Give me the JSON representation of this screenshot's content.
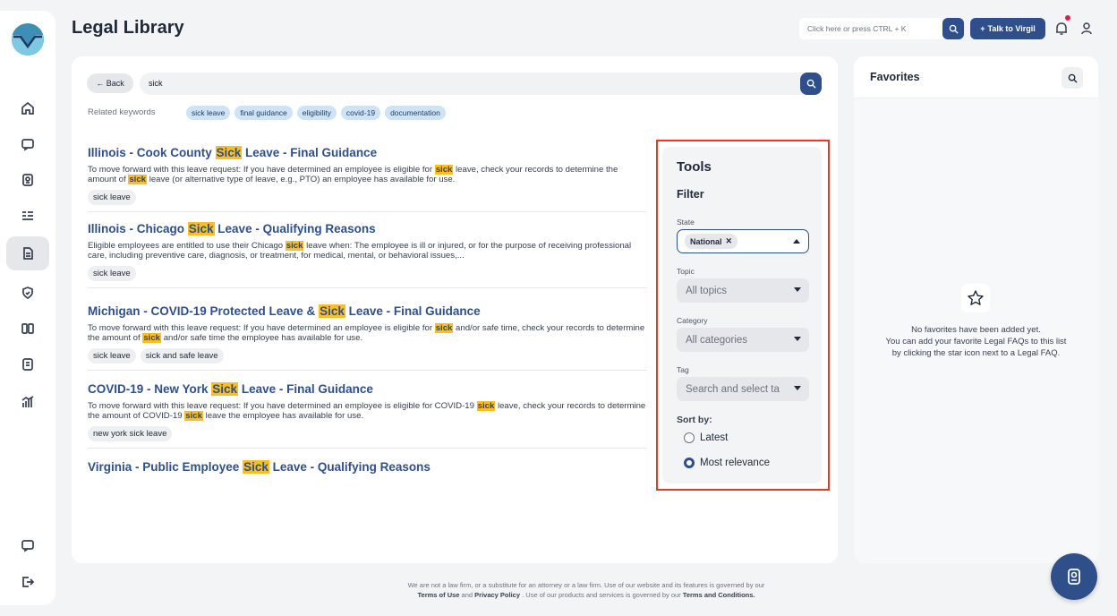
{
  "header": {
    "title": "Legal Library",
    "search_placeholder": "Click here or press CTRL + K",
    "talk_button": "Talk to Virgil"
  },
  "search": {
    "back_label": "← Back",
    "query": "sick",
    "related_label": "Related keywords",
    "keywords": [
      "sick leave",
      "final guidance",
      "eligibility",
      "covid-19",
      "documentation"
    ]
  },
  "results": [
    {
      "title_pre": "Illinois - Cook County ",
      "title_hl": "Sick",
      "title_post": " Leave - Final Guidance",
      "desc": [
        {
          "t": "To move forward with this leave request: If you have determined an employee is eligible for "
        },
        {
          "h": "sick"
        },
        {
          "t": " leave, check your records to determine the amount of "
        },
        {
          "h": "sick"
        },
        {
          "t": " leave (or alternative type of leave, e.g., PTO) an employee has available for use."
        }
      ],
      "tags": [
        "sick leave"
      ]
    },
    {
      "title_pre": "Illinois - Chicago ",
      "title_hl": "Sick",
      "title_post": " Leave - Qualifying Reasons",
      "desc": [
        {
          "t": "Eligible employees are entitled to use their Chicago "
        },
        {
          "h": "sick"
        },
        {
          "t": " leave when: The employee is ill or injured, or for the purpose of receiving professional care, including preventive care, diagnosis, or treatment, for medical, mental, or behavioral issues,..."
        }
      ],
      "tags": [
        "sick leave"
      ]
    },
    {
      "title_pre": "Michigan - COVID-19 Protected Leave & ",
      "title_hl": "Sick",
      "title_post": " Leave - Final Guidance",
      "desc": [
        {
          "t": "To move forward with this leave request: If you have determined an employee is eligible for "
        },
        {
          "h": "sick"
        },
        {
          "t": " and/or safe time, check your records to determine the amount of "
        },
        {
          "h": "sick"
        },
        {
          "t": " and/or safe time the employee has available for use."
        }
      ],
      "tags": [
        "sick leave",
        "sick and safe leave"
      ]
    },
    {
      "title_pre": "COVID-19 - New York ",
      "title_hl": "Sick",
      "title_post": " Leave - Final Guidance",
      "desc": [
        {
          "t": "To move forward with this leave request: If you have determined an employee is eligible for COVID-19 "
        },
        {
          "h": "sick"
        },
        {
          "t": " leave, check your records to determine the amount of COVID-19 "
        },
        {
          "h": "sick"
        },
        {
          "t": " leave the employee has available for use."
        }
      ],
      "tags": [
        "new york sick leave"
      ]
    },
    {
      "title_pre": "Virginia - Public Employee ",
      "title_hl": "Sick",
      "title_post": " Leave - Qualifying Reasons",
      "desc": [],
      "tags": []
    }
  ],
  "tools": {
    "title": "Tools",
    "filter_title": "Filter",
    "state_label": "State",
    "state_value": "National",
    "topic_label": "Topic",
    "topic_placeholder": "All topics",
    "category_label": "Category",
    "category_placeholder": "All categories",
    "tag_label": "Tag",
    "tag_placeholder": "Search and select ta",
    "sort_label": "Sort by:",
    "sort_options": [
      "Latest",
      "Most relevance"
    ],
    "sort_selected": "Most relevance"
  },
  "favorites": {
    "title": "Favorites",
    "empty_line1": "No favorites have been added yet.",
    "empty_line2": "You can add your favorite Legal FAQs to this list",
    "empty_line3": "by clicking the star icon next to a Legal FAQ."
  },
  "footer": {
    "line1": "We are not a law firm, or a substitute for an attorney or a law firm. Use of our website and its features is governed by our",
    "terms_of_use": "Terms of Use",
    "and": " and ",
    "privacy": "Privacy Policy",
    "line2_mid": " . Use of our products and services is governed by our ",
    "terms_conditions": "Terms and Conditions."
  },
  "colors": {
    "brand": "#2f4f8a",
    "highlight": "#fbbf24",
    "annotation": "#e53b27"
  }
}
